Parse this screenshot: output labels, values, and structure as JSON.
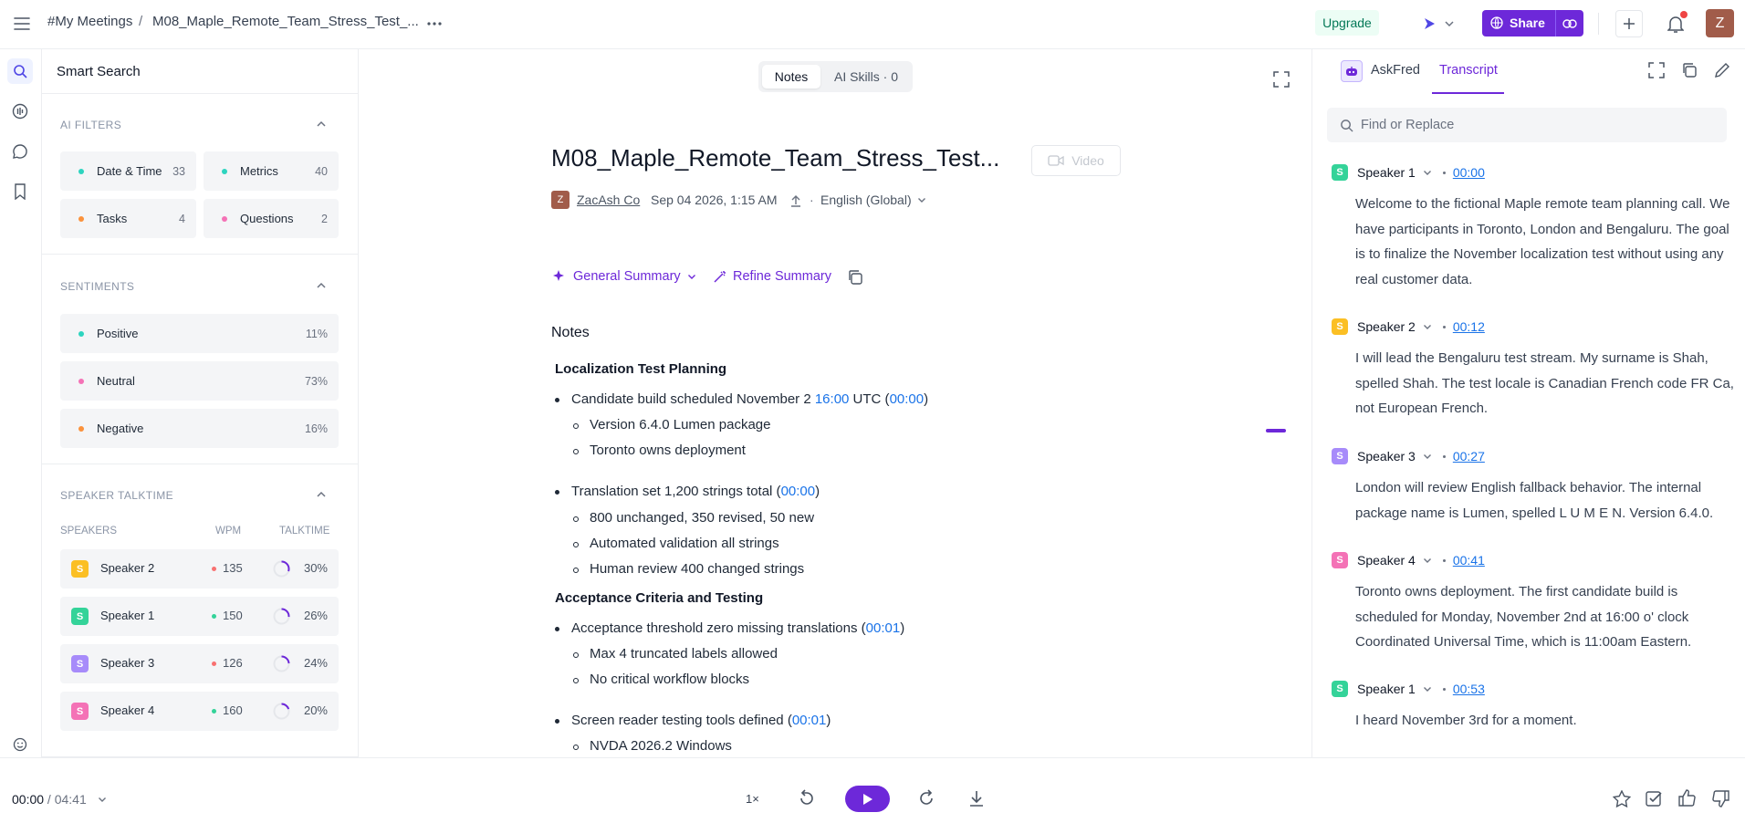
{
  "topbar": {
    "breadcrumb_root": "#My Meetings",
    "breadcrumb_sep": "/",
    "breadcrumb_title": "M08_Maple_Remote_Team_Stress_Test_...",
    "upgrade_label": "Upgrade",
    "share_label": "Share",
    "avatar_initial": "Z"
  },
  "sidebar": {
    "search_label": "Smart Search",
    "ai_filters": {
      "header": "AI FILTERS",
      "items": [
        {
          "label": "Date & Time",
          "count": "33",
          "color": "#2dd4bf"
        },
        {
          "label": "Metrics",
          "count": "40",
          "color": "#2dd4bf"
        },
        {
          "label": "Tasks",
          "count": "4",
          "color": "#fb923c"
        },
        {
          "label": "Questions",
          "count": "2",
          "color": "#f472b6"
        }
      ]
    },
    "sentiments": {
      "header": "SENTIMENTS",
      "items": [
        {
          "label": "Positive",
          "value": "11%",
          "color": "#2dd4bf"
        },
        {
          "label": "Neutral",
          "value": "73%",
          "color": "#f472b6"
        },
        {
          "label": "Negative",
          "value": "16%",
          "color": "#fb923c"
        }
      ]
    },
    "talktime": {
      "header": "SPEAKER TALKTIME",
      "col_speakers": "SPEAKERS",
      "col_wpm": "WPM",
      "col_talktime": "TALKTIME",
      "rows": [
        {
          "initial": "S",
          "name": "Speaker 2",
          "wpm": "135",
          "talktime": "30%",
          "badge_color": "#fbbf24",
          "wpm_color": "#f87171",
          "fraction": 0.3
        },
        {
          "initial": "S",
          "name": "Speaker 1",
          "wpm": "150",
          "talktime": "26%",
          "badge_color": "#34d399",
          "wpm_color": "#34d399",
          "fraction": 0.26
        },
        {
          "initial": "S",
          "name": "Speaker 3",
          "wpm": "126",
          "talktime": "24%",
          "badge_color": "#a78bfa",
          "wpm_color": "#f87171",
          "fraction": 0.24
        },
        {
          "initial": "S",
          "name": "Speaker 4",
          "wpm": "160",
          "talktime": "20%",
          "badge_color": "#f472b6",
          "wpm_color": "#34d399",
          "fraction": 0.2
        }
      ]
    }
  },
  "main": {
    "tabs": {
      "notes": "Notes",
      "ai_skills": "AI Skills · 0"
    },
    "title": "M08_Maple_Remote_Team_Stress_Test...",
    "video_label": "Video",
    "owner_initial": "Z",
    "owner": "ZacAsh Co",
    "date": "Sep 04 2026, 1:15 AM",
    "sep_dot": "·",
    "language": "English (Global)",
    "summary_label": "General Summary",
    "refine_label": "Refine Summary",
    "notes_heading": "Notes",
    "sections": [
      {
        "heading": "Localization Test Planning",
        "bullets": [
          {
            "pre": "Candidate build scheduled November 2 ",
            "highlight": "16:00",
            "mid": " UTC (",
            "ts": "00:00",
            "post": ")",
            "subs": [
              "Version 6.4.0 Lumen package",
              "Toronto owns deployment"
            ]
          },
          {
            "pre": "Translation set 1,200 strings total (",
            "highlight": "",
            "mid": "",
            "ts": "00:00",
            "post": ")",
            "subs": [
              "800 unchanged, 350 revised, 50 new",
              "Automated validation all strings",
              "Human review 400 changed strings"
            ]
          }
        ]
      },
      {
        "heading": "Acceptance Criteria and Testing",
        "bullets": [
          {
            "pre": "Acceptance threshold zero missing translations (",
            "highlight": "",
            "mid": "",
            "ts": "00:01",
            "post": ")",
            "subs": [
              "Max 4 truncated labels allowed",
              "No critical workflow blocks"
            ]
          },
          {
            "pre": "Screen reader testing tools defined (",
            "highlight": "",
            "mid": "",
            "ts": "00:01",
            "post": ")",
            "subs": [
              "NVDA 2026.2 Windows"
            ]
          }
        ]
      }
    ]
  },
  "right_panel": {
    "tab_askfred": "AskFred",
    "tab_transcript": "Transcript",
    "search_placeholder": "Find or Replace",
    "entries": [
      {
        "initial": "S",
        "speaker": "Speaker 1",
        "ts": "00:00",
        "color": "#34d399",
        "text": "Welcome to the fictional Maple remote team planning call. We have participants in Toronto, London and Bengaluru. The goal is to finalize the November localization test without using any real customer data."
      },
      {
        "initial": "S",
        "speaker": "Speaker 2",
        "ts": "00:12",
        "color": "#fbbf24",
        "text": "I will lead the Bengaluru test stream. My surname is Shah, spelled Shah. The test locale is Canadian French code FR Ca, not European French."
      },
      {
        "initial": "S",
        "speaker": "Speaker 3",
        "ts": "00:27",
        "color": "#a78bfa",
        "text": "London will review English fallback behavior. The internal package name is Lumen, spelled L U M E N. Version 6.4.0."
      },
      {
        "initial": "S",
        "speaker": "Speaker 4",
        "ts": "00:41",
        "color": "#f472b6",
        "text": "Toronto owns deployment. The first candidate build is scheduled for Monday, November 2nd at 16:00 o' clock Coordinated Universal Time, which is 11:00am Eastern."
      },
      {
        "initial": "S",
        "speaker": "Speaker 1",
        "ts": "00:53",
        "color": "#34d399",
        "text": "I heard November 3rd for a moment."
      }
    ]
  },
  "player": {
    "current_time": "00:00",
    "separator": " / ",
    "duration": "04:41",
    "speed": "1×"
  },
  "colors": {
    "accent": "#6d28d9",
    "link": "#1a73e8",
    "upgrade_bg": "#ecfdf5",
    "upgrade_text": "#047857"
  }
}
